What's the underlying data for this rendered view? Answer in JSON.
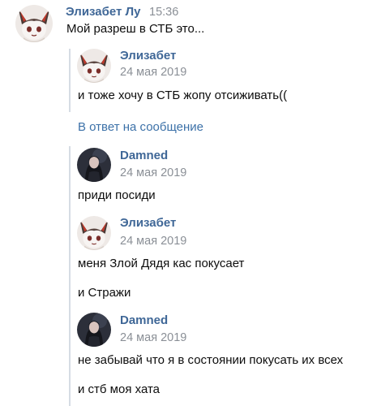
{
  "message": {
    "author": "Элизабет Лу",
    "time": "15:36",
    "text": "Мой разреш в СТБ это..."
  },
  "forwarded": [
    {
      "author": "Элизабет",
      "date": "24 мая 2019",
      "texts": [
        "и тоже хочу в СТБ жопу отсиживать(("
      ]
    }
  ],
  "reply_link": "В ответ на сообщение",
  "replies": [
    {
      "author": "Damned",
      "date": "24 мая 2019",
      "texts": [
        "приди посиди"
      ]
    },
    {
      "author": "Элизабет",
      "date": "24 мая 2019",
      "texts": [
        "меня Злой Дядя кас покусает",
        "и Стражи"
      ]
    },
    {
      "author": "Damned",
      "date": "24 мая 2019",
      "texts": [
        "не забывай что я в состоянии покусать их всех",
        "и стб моя хата"
      ]
    }
  ],
  "colors": {
    "author_name": "#3f6797",
    "time": "#8a8f96",
    "link": "#3c71a8",
    "quote_bar": "#d6dce4"
  },
  "icons": {
    "elizabet_avatar": "anime-fox-girl-avatar",
    "damned_avatar": "dark-hair-girl-avatar"
  }
}
